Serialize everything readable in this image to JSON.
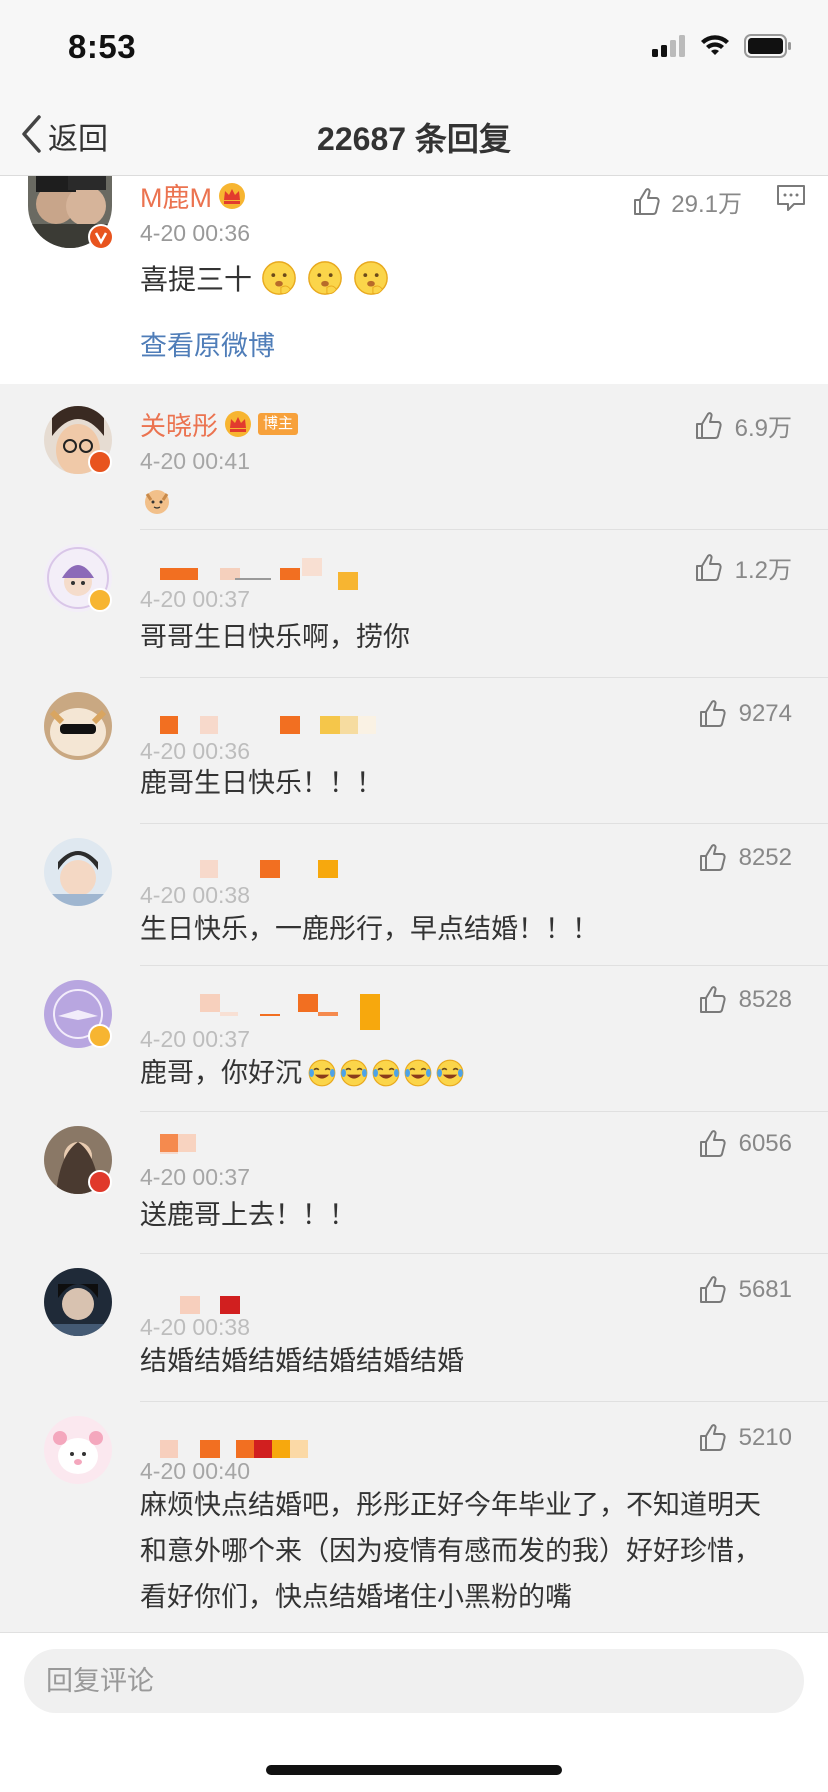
{
  "status": {
    "time": "8:53"
  },
  "nav": {
    "back_label": "返回",
    "title": "22687 条回复"
  },
  "root": {
    "name": "M鹿M",
    "time": "4-20 00:36",
    "text": "喜提三十",
    "likes": "29.1万",
    "view_original": "查看原微博"
  },
  "replies": [
    {
      "name": "关晓彤",
      "tag": "博主",
      "time": "4-20 00:41",
      "text": "",
      "likes": "6.9万"
    },
    {
      "time": "4-20 00:37",
      "text": "哥哥生日快乐啊，捞你",
      "likes": "1.2万"
    },
    {
      "time": "4-20 00:36",
      "text": "鹿哥生日快乐！！！",
      "likes": "9274"
    },
    {
      "time": "4-20 00:38",
      "text": "生日快乐，一鹿彤行，早点结婚！！！",
      "likes": "8252"
    },
    {
      "time": "4-20 00:37",
      "text": "鹿哥，你好沉",
      "likes": "8528"
    },
    {
      "time": "4-20 00:37",
      "text": "送鹿哥上去！！！",
      "likes": "6056"
    },
    {
      "time": "4-20 00:38",
      "text": "结婚结婚结婚结婚结婚结婚",
      "likes": "5681"
    },
    {
      "time": "4-20 00:40",
      "text": "麻烦快点结婚吧，彤彤正好今年毕业了，不知道明天和意外哪个来（因为疫情有感而发的我）好好珍惜，看好你们，快点结婚堵住小黑粉的嘴",
      "likes": "5210"
    }
  ],
  "bottom": {
    "placeholder": "回复评论"
  },
  "colors": {
    "name": "#eb7350",
    "link": "#4f7db8",
    "verified": "#e8541e",
    "tag": "#f7a13b"
  }
}
